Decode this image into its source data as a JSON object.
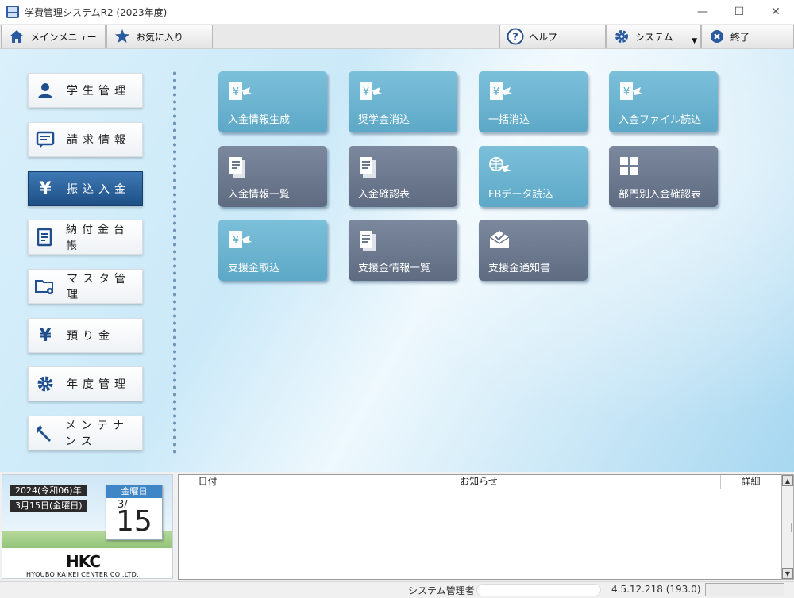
{
  "window": {
    "title": "学費管理システムR2 (2023年度)",
    "min": "—",
    "max": "☐",
    "close": "✕"
  },
  "toolbar": {
    "menu": "メインメニュー",
    "favorites": "お気に入り",
    "help": "ヘルプ",
    "system": "システム",
    "exit": "終了"
  },
  "sidebar": {
    "items": [
      {
        "label": "学生管理",
        "icon": "student-icon"
      },
      {
        "label": "請求情報",
        "icon": "invoice-icon"
      },
      {
        "label": "振込入金",
        "icon": "yen-icon",
        "active": true
      },
      {
        "label": "納付金台帳",
        "icon": "ledger-icon"
      },
      {
        "label": "マスタ管理",
        "icon": "folder-gear-icon"
      },
      {
        "label": "預り金",
        "icon": "yen-icon"
      },
      {
        "label": "年度管理",
        "icon": "gear-icon"
      },
      {
        "label": "メンテナンス",
        "icon": "wrench-icon"
      }
    ]
  },
  "tiles": [
    {
      "label": "入金情報生成",
      "color": "blue",
      "icon": "yen-doc-icon"
    },
    {
      "label": "奨学金消込",
      "color": "blue",
      "icon": "yen-doc-icon"
    },
    {
      "label": "一括消込",
      "color": "blue",
      "icon": "yen-doc-icon"
    },
    {
      "label": "入金ファイル読込",
      "color": "blue",
      "icon": "yen-doc-icon"
    },
    {
      "label": "入金情報一覧",
      "color": "slate",
      "icon": "doc-list-icon"
    },
    {
      "label": "入金確認表",
      "color": "slate",
      "icon": "doc-list-icon"
    },
    {
      "label": "FBデータ読込",
      "color": "blue",
      "icon": "globe-import-icon"
    },
    {
      "label": "部門別入金確認表",
      "color": "slate",
      "icon": "grid-icon"
    },
    {
      "label": "支援金取込",
      "color": "blue",
      "icon": "yen-doc-icon"
    },
    {
      "label": "支援金情報一覧",
      "color": "slate",
      "icon": "doc-list-icon"
    },
    {
      "label": "支援金通知書",
      "color": "slate",
      "icon": "envelope-icon"
    }
  ],
  "calendar": {
    "year": "2024(令和06)年",
    "date": "3月15日(金曜日)",
    "weekday": "金曜日",
    "month": "3/",
    "day": "15"
  },
  "brand": {
    "logo": "HKC",
    "company": "HYOUBO KAIKEI CENTER CO.,LTD."
  },
  "news": {
    "columns": [
      "日付",
      "お知らせ",
      "詳細"
    ]
  },
  "status": {
    "user": "システム管理者",
    "version": "4.5.12.218 (193.0)"
  },
  "colors": {
    "tile_blue": "#6ab3cf",
    "tile_slate": "#6b778c",
    "active": "#2a5f98"
  }
}
